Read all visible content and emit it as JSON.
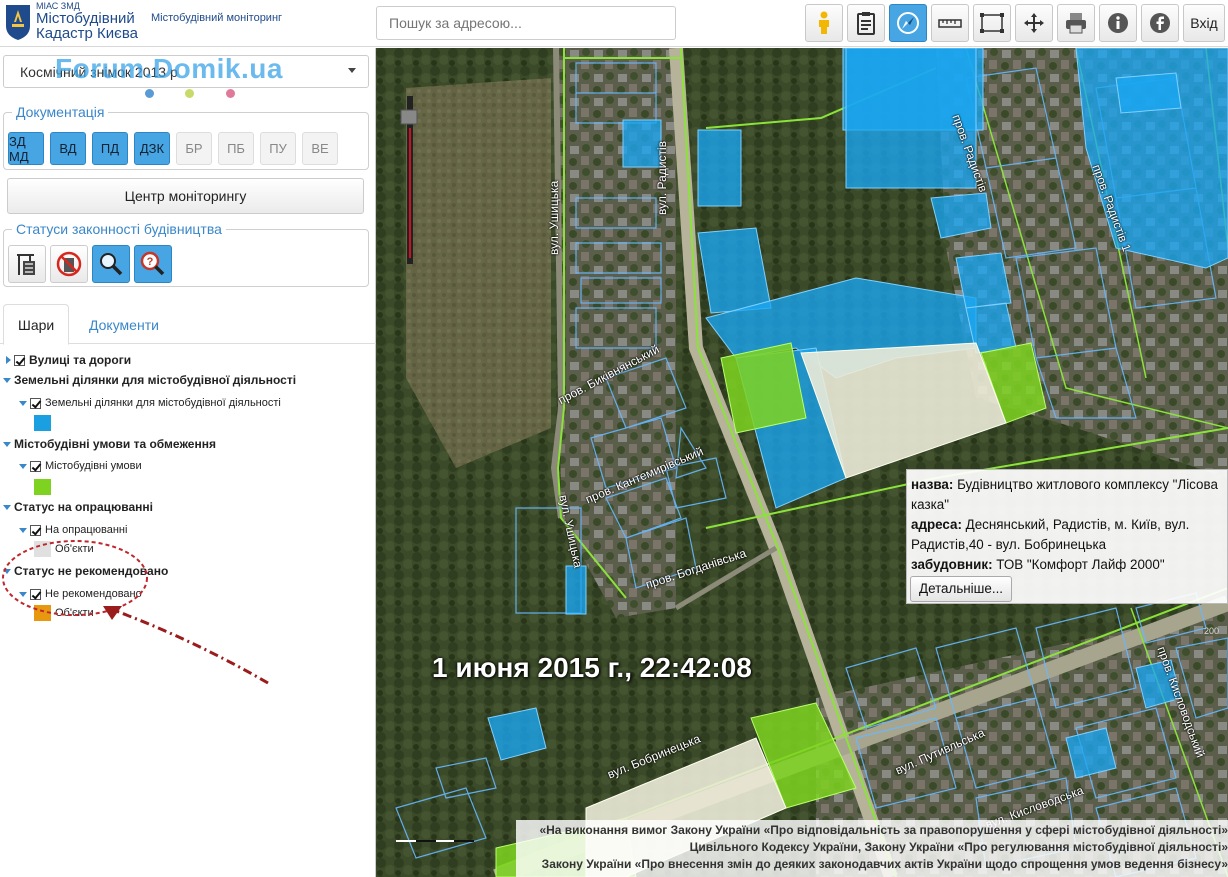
{
  "header": {
    "brand_small": "МІАС ЗМД",
    "brand_line1": "Містобудівний",
    "brand_line2": "Кадастр Києва",
    "brand_subtitle": "Містобудівний моніторинг",
    "search_placeholder": "Пошук за адресою...",
    "toolbar_icons": [
      "person-icon",
      "clipboard-icon",
      "compass-icon",
      "ruler-icon",
      "area-measure-icon",
      "move-icon",
      "print-icon",
      "info-icon",
      "facebook-icon"
    ],
    "login_label": "Вхід"
  },
  "sidebar": {
    "basemap_value": "Космічний знімок 2013 р",
    "watermark": "Forum.Domik.ua",
    "dot_colors": [
      "#5b9bd5",
      "#c9d96a",
      "#e07a9a"
    ],
    "documentation": {
      "legend": "Документація",
      "buttons": [
        {
          "label": "ЗД МД",
          "active": true
        },
        {
          "label": "ВД",
          "active": true
        },
        {
          "label": "ПД",
          "active": true
        },
        {
          "label": "ДЗК",
          "active": true
        },
        {
          "label": "БР",
          "active": false
        },
        {
          "label": "ПБ",
          "active": false
        },
        {
          "label": "ПУ",
          "active": false
        },
        {
          "label": "ВЕ",
          "active": false
        }
      ]
    },
    "monitoring_center_label": "Центр моніторингу",
    "statuses": {
      "legend": "Статуси законності будівництва",
      "icons": [
        "building-crane-icon",
        "no-building-icon",
        "magnifier-icon",
        "magnifier-question-icon"
      ]
    },
    "tabs": [
      "Шари",
      "Документи"
    ],
    "layers": {
      "streets": "Вулиці та дороги",
      "land_group": "Земельні ділянки для містобудівної діяльності",
      "land_item": "Земельні ділянки для містобудівної діяльності",
      "land_color": "#1a9fe0",
      "conditions_group": "Містобудівні умови та обмеження",
      "conditions_item": "Містобудівні умови",
      "conditions_color": "#7ed321",
      "processing_group": "Статус на опрацюванні",
      "processing_item": "На опрацюванні",
      "processing_objects": "Об'єкти",
      "processing_color": "#e0e0e0",
      "notrec_group": "Статус не рекомендовано",
      "notrec_item": "Не рекомендовано",
      "notrec_objects": "Об'єкти",
      "notrec_color": "#e8980f"
    }
  },
  "map": {
    "streets": {
      "ushytska": "вул. Ушицька",
      "radystiv": "вул. Радистів",
      "prov_radystiv": "пров. Радистів",
      "prov_radystiv_2": "пров. Радистів 1",
      "bykivnianskyi": "пров. Биківнянський",
      "kantemyrivskyi": "пров. Кантемирівський",
      "ushytska2": "вул. Ушицька",
      "bobrynetska": "вул. Бобринецька",
      "putyvlska": "вул. Путивльська",
      "kyslovodska": "вул. Кисловодська",
      "prov_kyslovodskyi": "пров. Кисловодський",
      "bogdanivska": "пров. Богданівська"
    },
    "timestamp": "1 июня 2015 г., 22:42:08",
    "popup": {
      "name_label": "назва:",
      "name_value": "Будівництво житлового комплексу \"Лісова казка\"",
      "address_label": "адреса:",
      "address_value": "Деснянський, Радистів, м. Київ, вул. Радистів,40 - вул. Бобринецька",
      "developer_label": "забудовник:",
      "developer_value": "ТОВ \"Комфорт Лайф 2000\"",
      "details_button": "Детальніше..."
    },
    "disclaimer": [
      "«На виконання вимог Закону України «Про відповідальність за правопорушення у сфері містобудівної діяльності»",
      "Цивільного Кодексу України, Закону України «Про регулювання містобудівної діяльності»",
      "Закону України «Про внесення змін до деяких законодавчих актів України щодо спрощення умов ведення бізнесу»"
    ]
  }
}
